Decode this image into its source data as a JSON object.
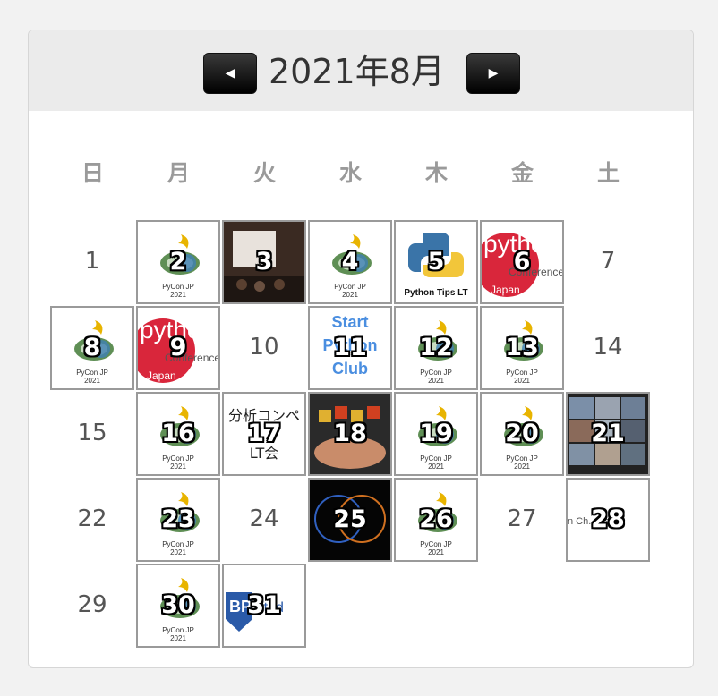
{
  "calendar": {
    "title": "2021年8月",
    "prev_label": "◀",
    "next_label": "▶",
    "weekdays": [
      "日",
      "月",
      "火",
      "水",
      "木",
      "金",
      "土"
    ],
    "days": [
      {
        "d": "1"
      },
      {
        "d": "2",
        "thumb": "pyconjp"
      },
      {
        "d": "3",
        "thumb": "photo"
      },
      {
        "d": "4",
        "thumb": "pyconjp"
      },
      {
        "d": "5",
        "thumb": "pytips"
      },
      {
        "d": "6",
        "thumb": "pyconlogo"
      },
      {
        "d": "7"
      },
      {
        "d": "8",
        "thumb": "pyconjp"
      },
      {
        "d": "9",
        "thumb": "pyconlogo"
      },
      {
        "d": "10"
      },
      {
        "d": "11",
        "thumb": "startpy"
      },
      {
        "d": "12",
        "thumb": "pyconjp"
      },
      {
        "d": "13",
        "thumb": "pyconjp"
      },
      {
        "d": "14"
      },
      {
        "d": "15"
      },
      {
        "d": "16",
        "thumb": "pyconjp"
      },
      {
        "d": "17",
        "thumb": "bunseki"
      },
      {
        "d": "18",
        "thumb": "photo2"
      },
      {
        "d": "19",
        "thumb": "pyconjp"
      },
      {
        "d": "20",
        "thumb": "pyconjp"
      },
      {
        "d": "21",
        "thumb": "zoom"
      },
      {
        "d": "22"
      },
      {
        "d": "23",
        "thumb": "pyconjp"
      },
      {
        "d": "24"
      },
      {
        "d": "25",
        "thumb": "dark"
      },
      {
        "d": "26",
        "thumb": "pyconjp"
      },
      {
        "d": "27"
      },
      {
        "d": "28",
        "thumb": "textonly"
      },
      {
        "d": "29"
      },
      {
        "d": "30",
        "thumb": "pyconjp"
      },
      {
        "d": "31",
        "thumb": "bpstudy"
      }
    ],
    "thumb_texts": {
      "pyconjp_caption": "PyCon JP",
      "pyconjp_year": "2021",
      "pytips": "Python Tips LT",
      "pyconlogo_a": "pytho",
      "pyconlogo_b": "Conference",
      "pyconlogo_c": "Japan",
      "startpy": "Start Python Club",
      "bunseki": "分析コンペ LT会",
      "bpstudy": "BPStud",
      "textonly": "n Ch... es in"
    },
    "colors": {
      "accent": "#000000",
      "header_bg": "#ebebeb",
      "border": "#9a9a9a",
      "weekday": "#9a9a9a"
    }
  }
}
